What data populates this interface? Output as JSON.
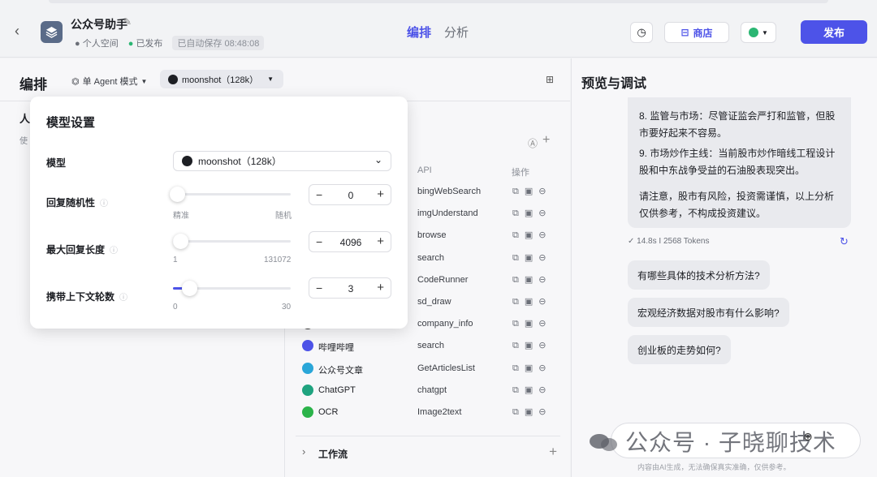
{
  "header": {
    "app_title": "公众号助手",
    "space": "个人空间",
    "published": "已发布",
    "autosave": "已自动保存 08:48:08",
    "tabs": [
      "编排",
      "分析"
    ],
    "store_label": "商店",
    "publish_label": "发布"
  },
  "left": {
    "section_title": "编排",
    "mode_label": "单 Agent 模式",
    "model_pill": "moonshot（128k）",
    "sub_title": "人",
    "sub_text": "使"
  },
  "model_popup": {
    "title": "模型设置",
    "model_label": "模型",
    "model_value": "moonshot（128k）",
    "params": [
      {
        "label": "回复随机性",
        "value": "0",
        "min_label": "精准",
        "max_label": "随机",
        "level": 0
      },
      {
        "label": "最大回复长度",
        "value": "4096",
        "min_label": "1",
        "max_label": "131072",
        "level": 0.03
      },
      {
        "label": "携带上下文轮数",
        "value": "3",
        "min_label": "0",
        "max_label": "30",
        "level": 0.1
      }
    ]
  },
  "plugins": {
    "api_header": "API",
    "ops_header": "操作",
    "rows": [
      {
        "name": "",
        "api": "bingWebSearch",
        "color": "#ffffff"
      },
      {
        "name": "",
        "api": "imgUnderstand",
        "color": "#ffffff"
      },
      {
        "name": "",
        "api": "browse",
        "color": "#ffffff"
      },
      {
        "name": "",
        "api": "search",
        "color": "#ffffff"
      },
      {
        "name": "",
        "api": "CodeRunner",
        "color": "#ffffff"
      },
      {
        "name": "",
        "api": "sd_draw",
        "color": "#ffffff"
      },
      {
        "name": "",
        "api": "company_info",
        "color": "#333333"
      },
      {
        "name": "哔哩哔哩",
        "api": "search",
        "color": "#4d53e8"
      },
      {
        "name": "公众号文章",
        "api": "GetArticlesList",
        "color": "#2aa6d8"
      },
      {
        "name": "ChatGPT",
        "api": "chatgpt",
        "color": "#1fa37f"
      },
      {
        "name": "OCR",
        "api": "Image2text",
        "color": "#2bb34a"
      }
    ],
    "workflow_label": "工作流"
  },
  "preview": {
    "title": "预览与调试",
    "lines": [
      "8. 监管与市场：尽管证监会严打和监管，但股市要好起来不容易。",
      "9. 市场炒作主线：当前股市炒作暗线工程设计股和中东战争受益的石油股表现突出。",
      "请注意，股市有风险，投资需谨慎，以上分析仅供参考，不构成投资建议。"
    ],
    "stats": "✓ 14.8s  I  2568 Tokens",
    "suggestions": [
      "有哪些具体的技术分析方法?",
      "宏观经济数据对股市有什么影响?",
      "创业板的走势如何?"
    ],
    "watermark": "公众号 · 子晓聊技术",
    "footnote": "内容由AI生成，无法确保真实准确，仅供参考。"
  }
}
